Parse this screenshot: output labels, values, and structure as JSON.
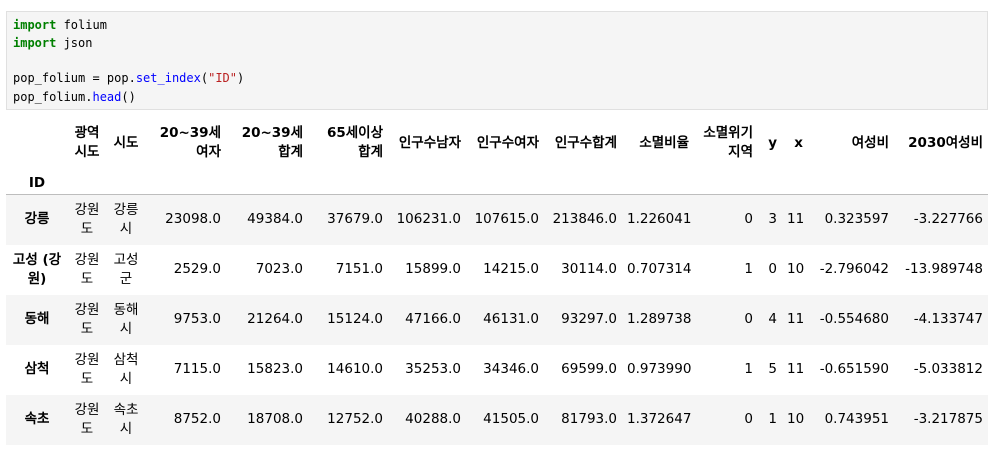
{
  "code": {
    "line1": {
      "kw": "import",
      "rest": " folium"
    },
    "line2": {
      "kw": "import",
      "rest": " json"
    },
    "line3": {
      "a": "pop_folium = pop.",
      "fn1": "set_index",
      "b": "(",
      "str1": "\"ID\"",
      "c": ")"
    },
    "line4": {
      "a": "pop_folium.",
      "fn1": "head",
      "b": "()"
    }
  },
  "table": {
    "index_name": "ID",
    "columns": [
      "광역시도",
      "시도",
      "20~39세 여자",
      "20~39세 합계",
      "65세이상 합계",
      "인구수남자",
      "인구수여자",
      "인구수합계",
      "소멸비율",
      "소멸위기지역",
      "y",
      "x",
      "여성비",
      "2030여성비"
    ],
    "rows": [
      {
        "index": "강릉",
        "cells": [
          "강원도",
          "강릉시",
          "23098.0",
          "49384.0",
          "37679.0",
          "106231.0",
          "107615.0",
          "213846.0",
          "1.226041",
          "0",
          "3",
          "11",
          "0.323597",
          "-3.227766"
        ]
      },
      {
        "index": "고성 (강원)",
        "cells": [
          "강원도",
          "고성군",
          "2529.0",
          "7023.0",
          "7151.0",
          "15899.0",
          "14215.0",
          "30114.0",
          "0.707314",
          "1",
          "0",
          "10",
          "-2.796042",
          "-13.989748"
        ]
      },
      {
        "index": "동해",
        "cells": [
          "강원도",
          "동해시",
          "9753.0",
          "21264.0",
          "15124.0",
          "47166.0",
          "46131.0",
          "93297.0",
          "1.289738",
          "0",
          "4",
          "11",
          "-0.554680",
          "-4.133747"
        ]
      },
      {
        "index": "삼척",
        "cells": [
          "강원도",
          "삼척시",
          "7115.0",
          "15823.0",
          "14610.0",
          "35253.0",
          "34346.0",
          "69599.0",
          "0.973990",
          "1",
          "5",
          "11",
          "-0.651590",
          "-5.033812"
        ]
      },
      {
        "index": "속초",
        "cells": [
          "강원도",
          "속초시",
          "8752.0",
          "18708.0",
          "12752.0",
          "40288.0",
          "41505.0",
          "81793.0",
          "1.372647",
          "0",
          "1",
          "10",
          "0.743951",
          "-3.217875"
        ]
      }
    ]
  }
}
